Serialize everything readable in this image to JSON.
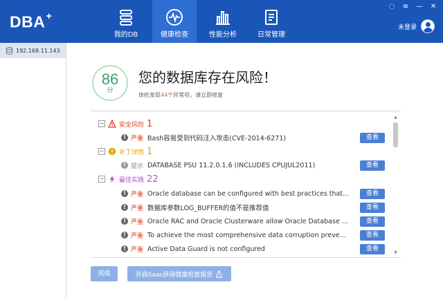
{
  "app": {
    "logo": "DBA",
    "logo_plus": "+"
  },
  "nav": {
    "items": [
      {
        "label": "我的DB",
        "icon": "server-stack-icon"
      },
      {
        "label": "健康检查",
        "icon": "pulse-monitor-icon",
        "active": true
      },
      {
        "label": "性能分析",
        "icon": "bar-chart-icon"
      },
      {
        "label": "日常管理",
        "icon": "document-list-icon"
      }
    ]
  },
  "window": {
    "controls": [
      "chat-icon",
      "menu-icon",
      "minimize-icon",
      "close-icon"
    ]
  },
  "user": {
    "label": "未登录"
  },
  "sidebar": {
    "items": [
      {
        "label": "192.168.11.143",
        "icon": "database-icon"
      }
    ]
  },
  "score": {
    "value": "86",
    "unit": "分"
  },
  "headline": "您的数据库存在风险！",
  "subline": {
    "prefix": "体检发现",
    "count": "44",
    "suffix": "个异常项，请立即修复"
  },
  "categories": [
    {
      "label": "安全风险",
      "count": "1",
      "color": "#d9431e",
      "icon": "warning-triangle-icon"
    },
    {
      "label": "补丁详情",
      "count": "1",
      "color": "#e5a50a",
      "icon": "exclamation-circle-icon"
    },
    {
      "label": "最佳实践",
      "count": "22",
      "color": "#b04fc3",
      "icon": "lightning-icon"
    }
  ],
  "issues": [
    {
      "severity": "严重",
      "desc": "Bash容易受到代码注入攻击(CVE-2014-6271)",
      "action": "查看"
    },
    {
      "severity": "提示",
      "desc": "DATABASE PSU 11.2.0.1.6 (INCLUDES CPUJUL2011)",
      "action": "查看"
    },
    {
      "severity": "严重",
      "desc": "Oracle database can be configured with best practices that...",
      "action": "查看"
    },
    {
      "severity": "严重",
      "desc": "数据库参数LOG_BUFFER的值不是推荐值",
      "action": "查看"
    },
    {
      "severity": "严重",
      "desc": "Oracle RAC and Oracle Clusterware allow Oracle Database ...",
      "action": "查看"
    },
    {
      "severity": "严重",
      "desc": "To achieve the most comprehensive data corruption preve...",
      "action": "查看"
    },
    {
      "severity": "严重",
      "desc": "Active Data Guard is not configured",
      "action": "查看"
    }
  ],
  "footer": {
    "done": "完成",
    "saas": "开启Saas获得健康检查报告"
  },
  "colors": {
    "header": "#1a55b8",
    "active_tab": "#2f6fd3",
    "button": "#4a7fd6",
    "score": "#3aa066",
    "danger": "#d9431e"
  }
}
